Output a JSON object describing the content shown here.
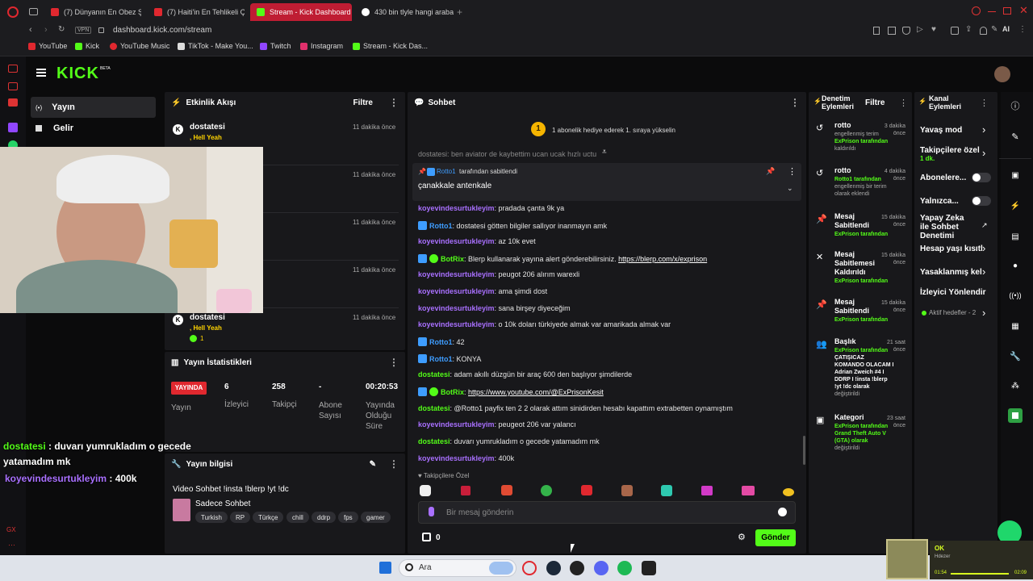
{
  "browser": {
    "tabs": [
      {
        "label": "(7) Dünyanın En Obez Şeh"
      },
      {
        "label": "(7) Haiti'in En Tehlikeli Çet"
      },
      {
        "label": "Stream - Kick Dashboard"
      },
      {
        "label": "430 bin tlyle hangi araba a"
      }
    ],
    "vpn": "VPN",
    "url": "dashboard.kick.com/stream",
    "ai": "AI",
    "bookmarks": [
      "YouTube",
      "Kick",
      "YouTube Music",
      "TikTok - Make You...",
      "Twitch",
      "Instagram",
      "Stream - Kick Das..."
    ]
  },
  "kick": {
    "logo": "KICK",
    "beta": "BETA",
    "nav": [
      {
        "label": "Yayın"
      },
      {
        "label": "Gelir"
      }
    ]
  },
  "activity": {
    "title": "Etkinlik Akışı",
    "filter": "Filtre",
    "items": [
      {
        "user": "dostatesi",
        "time": "11 dakika önce",
        "sub": ", Hell Yeah",
        "count": "1"
      },
      {
        "time": "11 dakika önce"
      },
      {
        "time": "11 dakika önce"
      },
      {
        "time": "11 dakika önce"
      },
      {
        "time": "11 dakika önce"
      },
      {
        "user": "dostatesi",
        "time": "11 dakika önce",
        "sub": ", Hell Yeah",
        "count": "1"
      }
    ]
  },
  "stats": {
    "title": "Yayın İstatistikleri",
    "live_badge": "YAYINDA",
    "live_label": "Yayın",
    "items": [
      {
        "value": "6",
        "label": "İzleyici"
      },
      {
        "value": "258",
        "label": "Takipçi"
      },
      {
        "value": "-",
        "label": "Abone Sayısı"
      },
      {
        "value": "00:20:53",
        "label": "Yayında Olduğu Süre"
      }
    ]
  },
  "info": {
    "title": "Yayın bilgisi",
    "stream_title": "Video Sohbet !insta !blerp !yt !dc",
    "category": "Sadece Sohbet",
    "tags": [
      "Turkish",
      "RP",
      "Türkçe",
      "chill",
      "ddrp",
      "fps",
      "gamer"
    ]
  },
  "overlay": {
    "messages": [
      {
        "user": "dostatesi",
        "text": " : duvarı yumrukladım o gecede yatamadım mk"
      },
      {
        "user": "koyevindesurtukleyim",
        "text": " : 400k"
      }
    ]
  },
  "chat": {
    "title": "Sohbet",
    "goal_number": "1",
    "goal_text": "1 abonelik hediye ederek 1. sıraya yükselin",
    "partial_text": "dostatesi: ben aviator de kaybettim ucan ucak hızlı uctu",
    "pinned_by_user": "Rotto1",
    "pinned_by_text": "tarafından sabitlendi",
    "pinned_text": "çanakkale antenkale",
    "messages": [
      {
        "user": "koyevindesurtukleyim",
        "text": ": pradada çanta 9k ya",
        "color": "#a970ff"
      },
      {
        "user": "Rotto1",
        "text": ": dostatesi götten bilgiler sallıyor inanmayın amk",
        "color": "#3e9dff"
      },
      {
        "user": "koyevindesurtukleyim",
        "text": ": az 10k evet",
        "color": "#a970ff"
      },
      {
        "user": "BotRix",
        "text": ": Blerp kullanarak yayına alert gönderebilirsiniz. ",
        "link": "https://blerp.com/x/exprison",
        "color": "#53fc18"
      },
      {
        "user": "koyevindesurtukleyim",
        "text": ": peugot 206 alırım warexli",
        "color": "#a970ff"
      },
      {
        "user": "koyevindesurtukleyim",
        "text": ": ama şimdi dost",
        "color": "#a970ff"
      },
      {
        "user": "koyevindesurtukleyim",
        "text": ": sana birşey diyeceğim",
        "color": "#a970ff"
      },
      {
        "user": "koyevindesurtukleyim",
        "text": ": o 10k doları türkiyede almak var amarikada almak var",
        "color": "#a970ff"
      },
      {
        "user": "Rotto1",
        "text": ": 42",
        "color": "#3e9dff"
      },
      {
        "user": "Rotto1",
        "text": ": KONYA",
        "color": "#3e9dff"
      },
      {
        "user": "dostatesi",
        "text": ": adam akıllı düzgün bir araç 600 den başlıyor şimdilerde",
        "color": "#53fc18"
      },
      {
        "user": "BotRix",
        "text": ": ",
        "link": "https://www.youtube.com/@ExPrisonKesit",
        "color": "#53fc18"
      },
      {
        "user": "dostatesi",
        "text": ": @Rotto1 payfix ten 2 2 olarak attım sinidirden hesabı kapattım extrabetten oynamıştım",
        "color": "#53fc18"
      },
      {
        "user": "koyevindesurtukleyim",
        "text": ": peugeot 206 var yalancı",
        "color": "#a970ff"
      },
      {
        "user": "dostatesi",
        "text": ": duvarı yumrukladım o gecede yatamadım mk",
        "color": "#53fc18"
      },
      {
        "user": "koyevindesurtukleyim",
        "text": ": 400k",
        "color": "#a970ff"
      }
    ],
    "followers_only": "Takipçilere Özel",
    "input_placeholder": "Bir mesaj gönderin",
    "points": "0",
    "send": "Gönder"
  },
  "mod": {
    "title": "Denetim Eylemleri",
    "filter": "Filtre",
    "items": [
      {
        "title": "rotto",
        "time": "3 dakika önce",
        "lines": [
          "engellenmiş terim",
          "ExPrison tarafından",
          "kaldırıldı"
        ]
      },
      {
        "title": "rotto",
        "time": "4 dakika önce",
        "lines": [
          "Rotto1 tarafından",
          "engellenmiş bir terim",
          "olarak eklendi"
        ]
      },
      {
        "title": "Mesaj Sabitlendi",
        "time": "15 dakika önce",
        "lines": [
          "ExPrison tarafından"
        ]
      },
      {
        "title": "Mesaj Sabitlemesi Kaldırıldı",
        "time": "15 dakika önce",
        "lines": [
          "ExPrison tarafından"
        ]
      },
      {
        "title": "Mesaj Sabitlendi",
        "time": "15 dakika önce",
        "lines": [
          "ExPrison tarafından"
        ]
      },
      {
        "title": "Başlık",
        "time": "21 saat önce",
        "lines": [
          "ExPrison tarafından",
          "ÇATIŞICAZ",
          "KOMANDO OLACAM I",
          "Adrian Zweich #4 I",
          "DDRP I !insta !blerp",
          "!yt !dc olarak",
          "değiştirildi"
        ]
      },
      {
        "title": "Kategori",
        "time": "23 saat önce",
        "lines": [
          "ExPrison tarafından",
          "Grand Theft Auto V",
          "(GTA) olarak",
          "değiştirildi"
        ]
      }
    ]
  },
  "channel": {
    "title": "Kanal Eylemleri",
    "items": [
      {
        "label": "Yavaş mod"
      },
      {
        "label": "Takipçilere özel",
        "sub": "1 dk."
      },
      {
        "label": "Abonelere..."
      },
      {
        "label": "Yalnızca..."
      },
      {
        "label": "Yapay Zeka ile Sohbet Denetimi"
      },
      {
        "label": "Hesap yaşı kısıtl"
      },
      {
        "label": "Yasaklanmış kel"
      },
      {
        "label": "İzleyici Yönlendir"
      }
    ],
    "goals": "Aktif hedefler - 2"
  },
  "taskbar": {
    "search": "Ara",
    "notification_title": "OK",
    "notification_sub": "Hdezer",
    "media_start": "01:54",
    "media_end": "02:09"
  },
  "colors": {
    "kick_green": "#53fc18",
    "tab_active": "#bf1d33",
    "live_red": "#e0282f"
  }
}
